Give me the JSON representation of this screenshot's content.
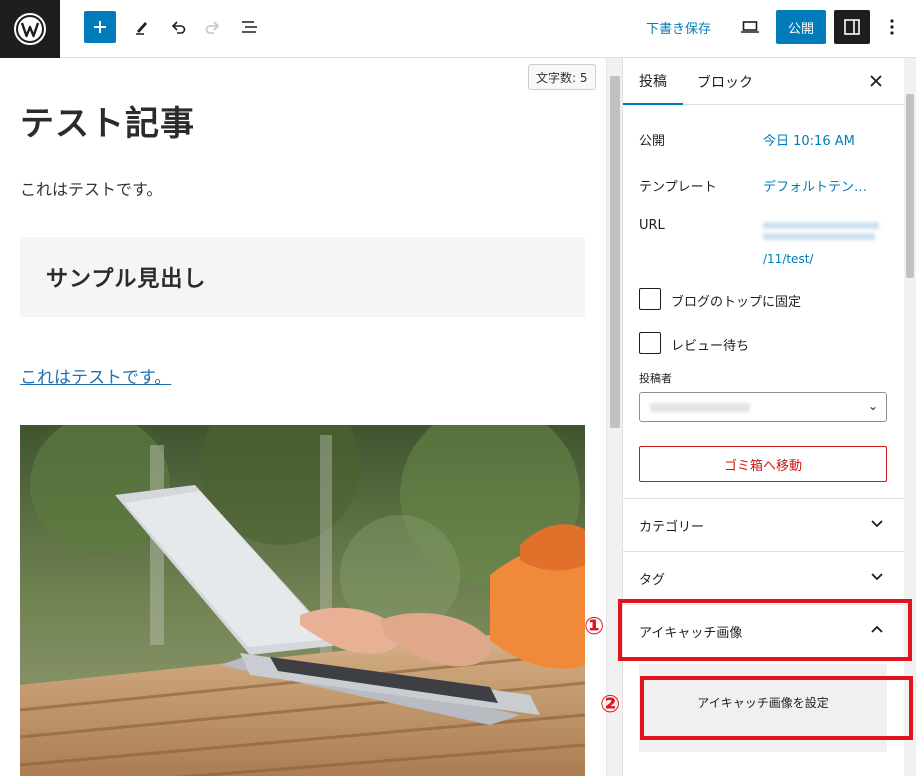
{
  "toolbar": {
    "draft_label": "下書き保存",
    "publish_label": "公開"
  },
  "editor": {
    "word_count": "文字数: 5",
    "title": "テスト記事",
    "paragraph": "これはテストです。",
    "heading": "サンプル見出し",
    "link_paragraph": "これはテストです。"
  },
  "sidebar": {
    "tabs": [
      "投稿",
      "ブロック"
    ],
    "publish": {
      "label": "公開",
      "value": "今日 10:16 AM"
    },
    "template": {
      "label": "テンプレート",
      "value": "デフォルトテン…"
    },
    "url": {
      "label": "URL",
      "value_visible": "/11/test/"
    },
    "checkboxes": [
      {
        "label": "ブログのトップに固定",
        "checked": false
      },
      {
        "label": "レビュー待ち",
        "checked": false
      }
    ],
    "author_label": "投稿者",
    "trash_label": "ゴミ箱へ移動",
    "panels": [
      "カテゴリー",
      "タグ",
      "アイキャッチ画像"
    ],
    "featured_button": "アイキャッチ画像を設定"
  },
  "annotations": [
    "①",
    "②"
  ],
  "colors": {
    "accent": "#007cba",
    "danger": "#cc1818",
    "annotation": "#e0141e",
    "dark": "#1e1e1e"
  }
}
